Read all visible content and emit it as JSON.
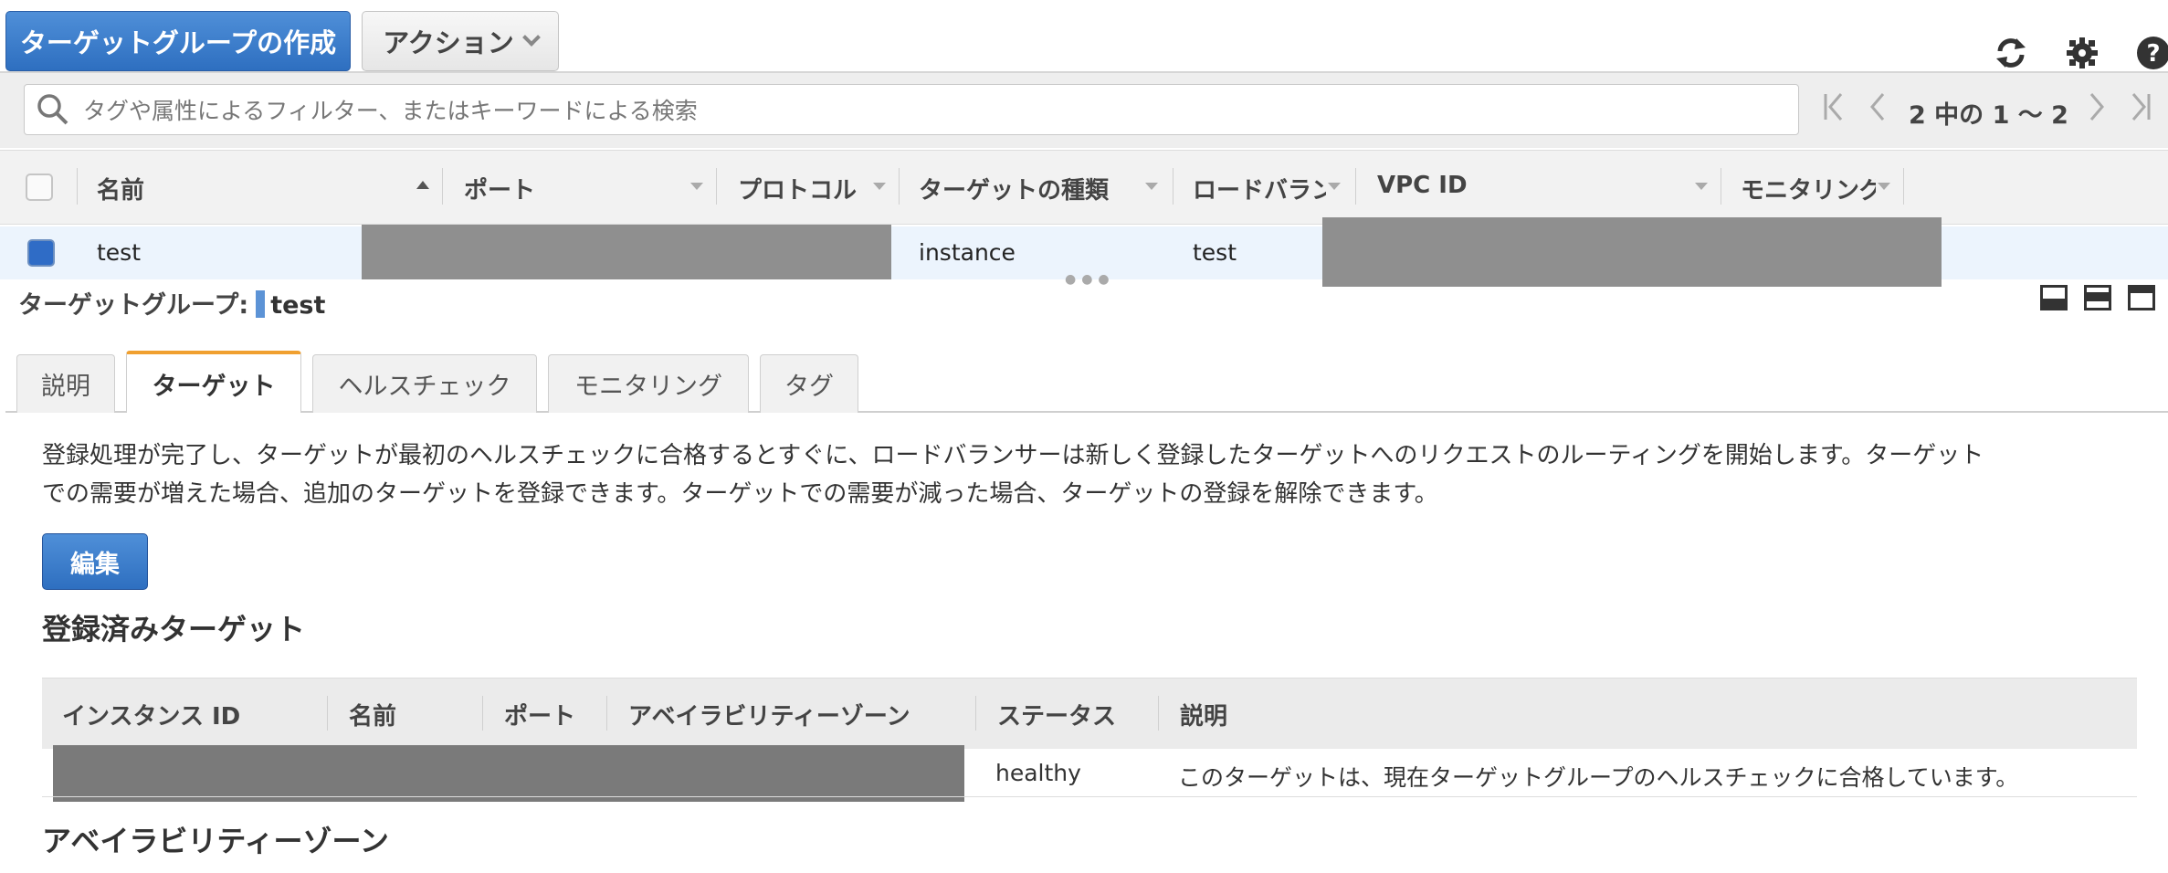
{
  "toolbar": {
    "create_label": "ターゲットグループの作成",
    "actions_label": "アクション",
    "refresh_icon": "refresh-icon",
    "settings_icon": "gear-icon",
    "help_icon": "help-icon"
  },
  "filter": {
    "placeholder": "タグや属性によるフィルター、またはキーワードによる検索",
    "page_count": "2 中の 1 ～ 2"
  },
  "grid": {
    "columns": [
      "名前",
      "ポート",
      "プロトコル",
      "ターゲットの種類",
      "ロードバラン",
      "VPC ID",
      "モニタリング"
    ],
    "rows": [
      {
        "name": "test",
        "target_type": "instance",
        "load_balancer": "test"
      }
    ]
  },
  "detail": {
    "title_label": "ターゲットグループ:",
    "title_value": "test",
    "tabs": [
      "説明",
      "ターゲット",
      "ヘルスチェック",
      "モニタリング",
      "タグ"
    ],
    "active_tab": "ターゲット",
    "description_line1": "登録処理が完了し、ターゲットが最初のヘルスチェックに合格するとすぐに、ロードバランサーは新しく登録したターゲットへのリクエストのルーティングを開始します。ターゲット",
    "description_line2": "での需要が増えた場合、追加のターゲットを登録できます。ターゲットでの需要が減った場合、ターゲットの登録を解除できます。",
    "edit_label": "編集",
    "registered_title": "登録済みターゲット",
    "targets_columns": [
      "インスタンス ID",
      "名前",
      "ポート",
      "アベイラビリティーゾーン",
      "ステータス",
      "説明"
    ],
    "targets_rows": [
      {
        "status": "healthy",
        "description": "このターゲットは、現在ターゲットグループのヘルスチェックに合格しています。"
      }
    ],
    "az_title": "アベイラビリティーゾーン"
  },
  "colors": {
    "primary": "#2e6fc0",
    "tab_accent": "#f0a030",
    "redaction": "#8f8f8f"
  }
}
